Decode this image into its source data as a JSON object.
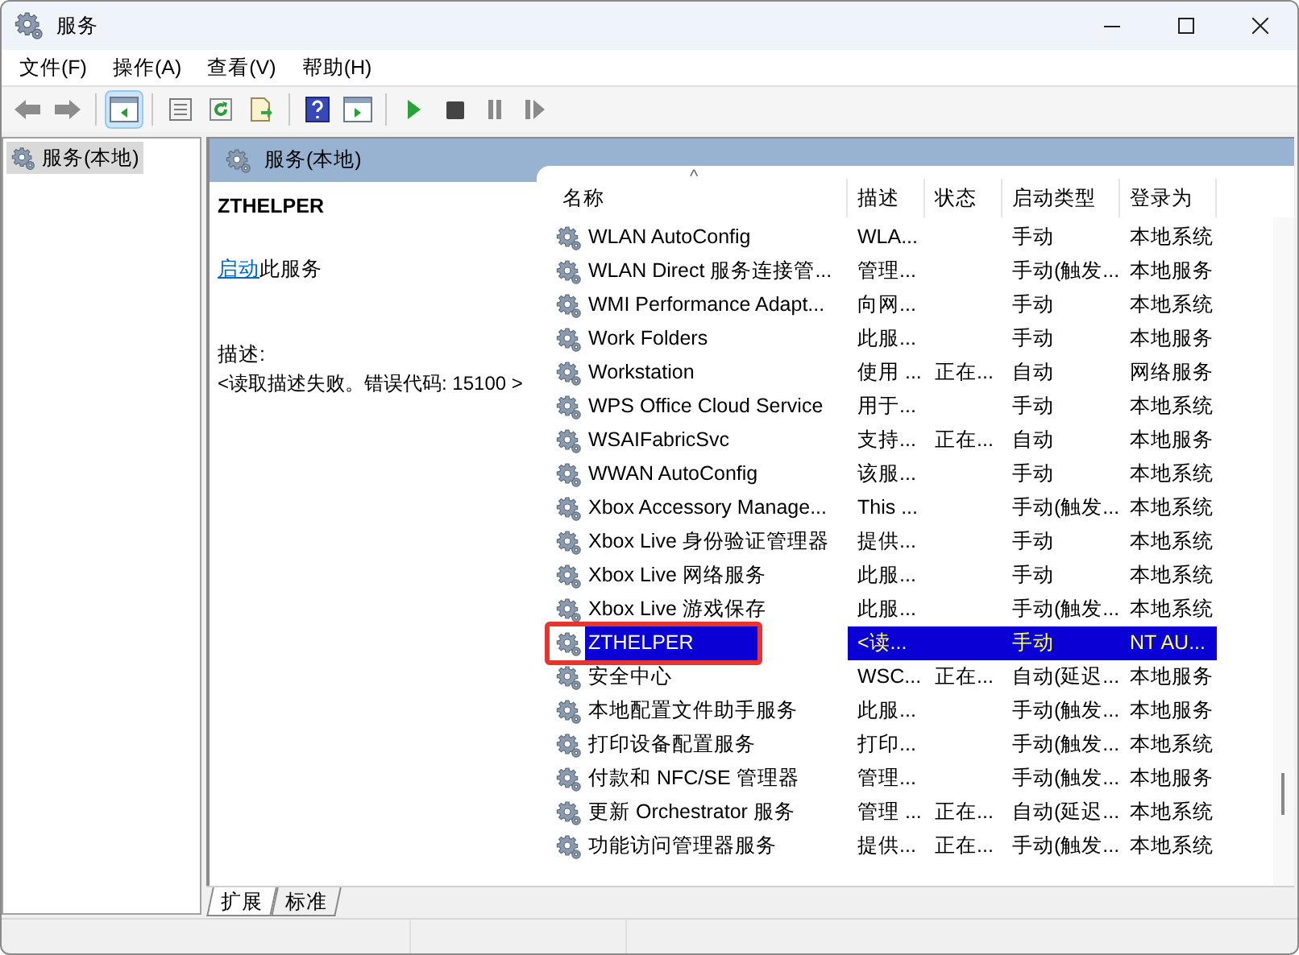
{
  "window": {
    "title": "服务"
  },
  "menu": [
    "文件(F)",
    "操作(A)",
    "查看(V)",
    "帮助(H)"
  ],
  "toolbar": [
    {
      "kind": "back"
    },
    {
      "kind": "forward"
    },
    {
      "kind": "sep"
    },
    {
      "kind": "tree",
      "selected": true
    },
    {
      "kind": "sep"
    },
    {
      "kind": "properties"
    },
    {
      "kind": "refresh"
    },
    {
      "kind": "export"
    },
    {
      "kind": "sep"
    },
    {
      "kind": "help"
    },
    {
      "kind": "console"
    },
    {
      "kind": "sep"
    },
    {
      "kind": "play"
    },
    {
      "kind": "stop"
    },
    {
      "kind": "pause"
    },
    {
      "kind": "resume"
    }
  ],
  "tree": {
    "items": [
      {
        "label": "服务(本地)",
        "selected": true
      }
    ]
  },
  "panel": {
    "title": "服务(本地)",
    "detail": {
      "service_name": "ZTHELPER",
      "action_link": "启动",
      "action_text": "此服务",
      "description_label": "描述:",
      "description": "<读取描述失败。错误代码: 15100 >"
    },
    "sort_indicator": "^",
    "columns": [
      "名称",
      "描述",
      "状态",
      "启动类型",
      "登录为"
    ],
    "rows": [
      {
        "name": "WLAN AutoConfig",
        "desc": "WLA...",
        "status": "",
        "startup": "手动",
        "logon": "本地系统",
        "selected": false,
        "marked": false
      },
      {
        "name": "WLAN Direct 服务连接管...",
        "desc": "管理...",
        "status": "",
        "startup": "手动(触发...",
        "logon": "本地服务",
        "selected": false,
        "marked": false
      },
      {
        "name": "WMI Performance Adapt...",
        "desc": "向网...",
        "status": "",
        "startup": "手动",
        "logon": "本地系统",
        "selected": false,
        "marked": false
      },
      {
        "name": "Work Folders",
        "desc": "此服...",
        "status": "",
        "startup": "手动",
        "logon": "本地服务",
        "selected": false,
        "marked": false
      },
      {
        "name": "Workstation",
        "desc": "使用 ...",
        "status": "正在...",
        "startup": "自动",
        "logon": "网络服务",
        "selected": false,
        "marked": false
      },
      {
        "name": "WPS Office Cloud Service",
        "desc": "用于...",
        "status": "",
        "startup": "手动",
        "logon": "本地系统",
        "selected": false,
        "marked": false
      },
      {
        "name": "WSAIFabricSvc",
        "desc": "支持...",
        "status": "正在...",
        "startup": "自动",
        "logon": "本地服务",
        "selected": false,
        "marked": false
      },
      {
        "name": "WWAN AutoConfig",
        "desc": "该服...",
        "status": "",
        "startup": "手动",
        "logon": "本地系统",
        "selected": false,
        "marked": false
      },
      {
        "name": "Xbox Accessory Manage...",
        "desc": "This ...",
        "status": "",
        "startup": "手动(触发...",
        "logon": "本地系统",
        "selected": false,
        "marked": false
      },
      {
        "name": "Xbox Live 身份验证管理器",
        "desc": "提供...",
        "status": "",
        "startup": "手动",
        "logon": "本地系统",
        "selected": false,
        "marked": false
      },
      {
        "name": "Xbox Live 网络服务",
        "desc": "此服...",
        "status": "",
        "startup": "手动",
        "logon": "本地系统",
        "selected": false,
        "marked": false
      },
      {
        "name": "Xbox Live 游戏保存",
        "desc": "此服...",
        "status": "",
        "startup": "手动(触发...",
        "logon": "本地系统",
        "selected": false,
        "marked": false
      },
      {
        "name": "ZTHELPER",
        "desc": "<读...",
        "status": "",
        "startup": "手动",
        "logon": "NT AU...",
        "selected": true,
        "marked": true
      },
      {
        "name": "安全中心",
        "desc": "WSC...",
        "status": "正在...",
        "startup": "自动(延迟...",
        "logon": "本地服务",
        "selected": false,
        "marked": false
      },
      {
        "name": "本地配置文件助手服务",
        "desc": "此服...",
        "status": "",
        "startup": "手动(触发...",
        "logon": "本地服务",
        "selected": false,
        "marked": false
      },
      {
        "name": "打印设备配置服务",
        "desc": "打印...",
        "status": "",
        "startup": "手动(触发...",
        "logon": "本地系统",
        "selected": false,
        "marked": false
      },
      {
        "name": "付款和 NFC/SE 管理器",
        "desc": "管理...",
        "status": "",
        "startup": "手动(触发...",
        "logon": "本地服务",
        "selected": false,
        "marked": false
      },
      {
        "name": "更新 Orchestrator 服务",
        "desc": "管理 ...",
        "status": "正在...",
        "startup": "自动(延迟...",
        "logon": "本地系统",
        "selected": false,
        "marked": false
      },
      {
        "name": "功能访问管理器服务",
        "desc": "提供...",
        "status": "正在...",
        "startup": "手动(触发...",
        "logon": "本地系统",
        "selected": false,
        "marked": false
      }
    ],
    "tabs": [
      {
        "label": "扩展",
        "selected": true
      },
      {
        "label": "标准",
        "selected": false
      }
    ]
  }
}
